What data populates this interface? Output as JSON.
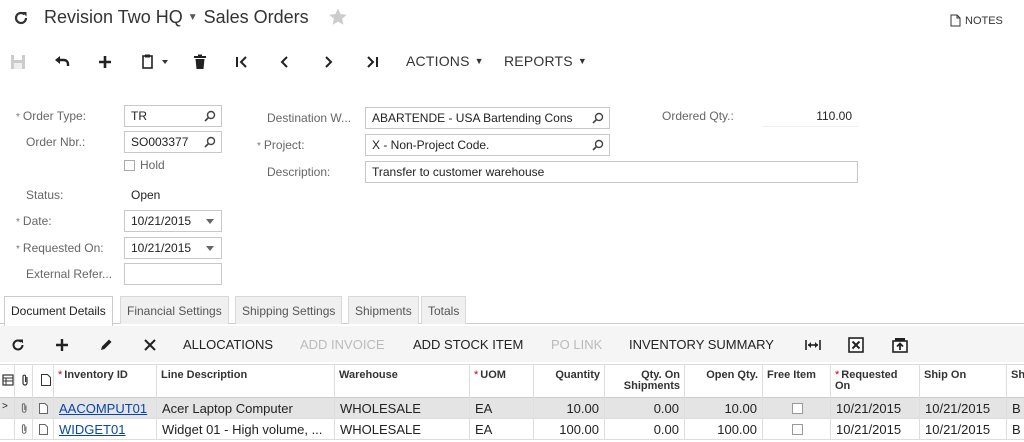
{
  "header": {
    "company": "Revision Two HQ",
    "screen": "Sales Orders",
    "notes_label": "NOTES"
  },
  "toolbar": {
    "actions_label": "ACTIONS",
    "reports_label": "REPORTS"
  },
  "form": {
    "order_type_label": "Order Type:",
    "order_type_value": "TR",
    "order_nbr_label": "Order Nbr.:",
    "order_nbr_value": "SO003377",
    "hold_label": "Hold",
    "status_label": "Status:",
    "status_value": "Open",
    "date_label": "Date:",
    "date_value": "10/21/2015",
    "requested_on_label": "Requested On:",
    "requested_on_value": "10/21/2015",
    "external_ref_label": "External Refer...",
    "external_ref_value": "",
    "destination_label": "Destination W...",
    "destination_value": "ABARTENDE - USA Bartending Cons",
    "project_label": "Project:",
    "project_value": "X - Non-Project Code.",
    "description_label": "Description:",
    "description_value": "Transfer to customer warehouse",
    "ordered_qty_label": "Ordered Qty.:",
    "ordered_qty_value": "110.00"
  },
  "tabs": [
    {
      "label": "Document Details"
    },
    {
      "label": "Financial Settings"
    },
    {
      "label": "Shipping Settings"
    },
    {
      "label": "Shipments"
    },
    {
      "label": "Totals"
    }
  ],
  "grid_toolbar": {
    "allocations": "ALLOCATIONS",
    "add_invoice": "ADD INVOICE",
    "add_stock_item": "ADD STOCK ITEM",
    "po_link": "PO LINK",
    "inventory_summary": "INVENTORY SUMMARY"
  },
  "grid": {
    "columns": {
      "inventory_id": "Inventory ID",
      "line_description": "Line Description",
      "warehouse": "Warehouse",
      "uom": "UOM",
      "quantity": "Quantity",
      "qty_on_shipments": "Qty. On Shipments",
      "open_qty": "Open Qty.",
      "free_item": "Free Item",
      "requested_on": "Requested On",
      "ship_on": "Ship On",
      "sh": "Sh"
    },
    "rows": [
      {
        "inventory_id": "AACOMPUT01",
        "line_description": "Acer Laptop Computer",
        "warehouse": "WHOLESALE",
        "uom": "EA",
        "quantity": "10.00",
        "qty_on_shipments": "0.00",
        "open_qty": "10.00",
        "requested_on": "10/21/2015",
        "ship_on": "10/21/2015",
        "sh": "B"
      },
      {
        "inventory_id": "WIDGET01",
        "line_description": "Widget 01 - High volume, ...",
        "warehouse": "WHOLESALE",
        "uom": "EA",
        "quantity": "100.00",
        "qty_on_shipments": "0.00",
        "open_qty": "100.00",
        "requested_on": "10/21/2015",
        "ship_on": "10/21/2015",
        "sh": "B"
      }
    ]
  }
}
